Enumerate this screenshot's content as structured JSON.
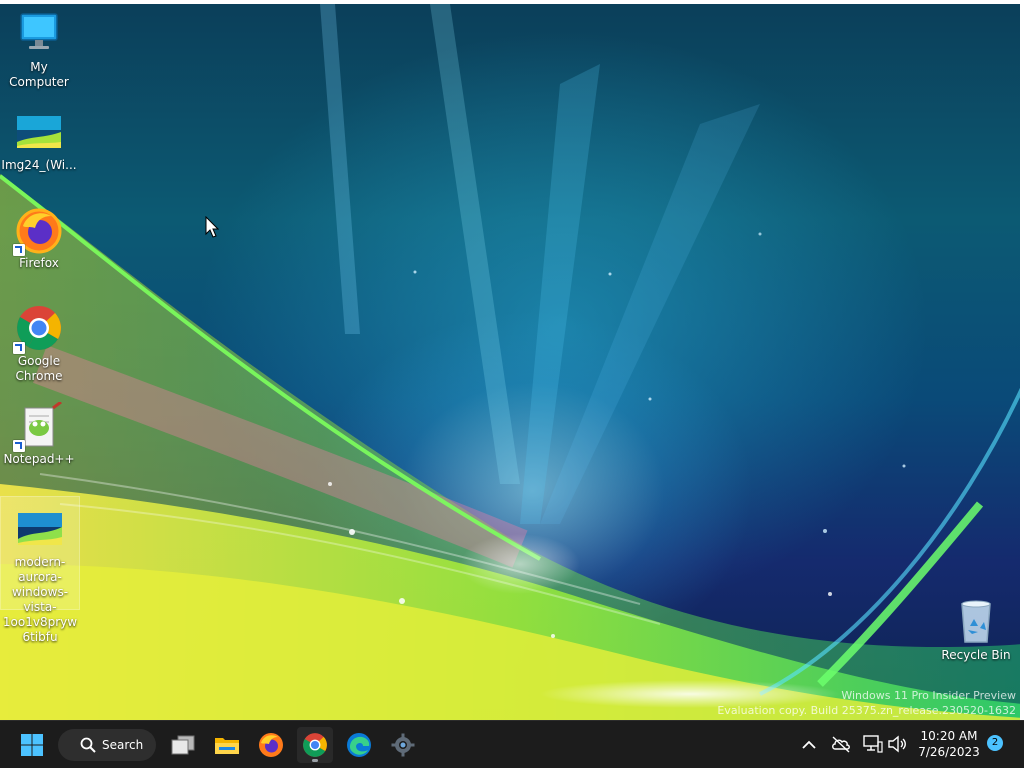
{
  "desktop": {
    "icons": [
      {
        "label": "My Computer",
        "icon": "monitor-icon",
        "shortcut": false
      },
      {
        "label": "Img24_(Wi...",
        "icon": "image-file-icon",
        "shortcut": false
      },
      {
        "label": "Firefox",
        "icon": "firefox-icon",
        "shortcut": true
      },
      {
        "label": "Google Chrome",
        "icon": "chrome-icon",
        "shortcut": true
      },
      {
        "label": "Notepad++",
        "icon": "notepad-plus-plus-icon",
        "shortcut": true
      },
      {
        "label": "modern-aurora-windows-vista-1oo1v8pryw6tibfu",
        "icon": "image-file-icon",
        "shortcut": false
      }
    ],
    "recycle_bin": {
      "label": "Recycle Bin",
      "icon": "recycle-bin-icon"
    }
  },
  "watermark": {
    "line1": "Windows 11 Pro Insider Preview",
    "line2": "Evaluation copy. Build 25375.zn_release.230520-1632"
  },
  "taskbar": {
    "start": {
      "icon": "windows-start-icon"
    },
    "search": {
      "label": "Search",
      "icon": "search-icon"
    },
    "apps": [
      {
        "name": "Task View",
        "icon": "task-view-icon",
        "active": false
      },
      {
        "name": "File Explorer",
        "icon": "file-explorer-icon",
        "active": false
      },
      {
        "name": "Firefox",
        "icon": "firefox-icon",
        "active": false
      },
      {
        "name": "Google Chrome",
        "icon": "chrome-icon",
        "active": true
      },
      {
        "name": "Microsoft Edge",
        "icon": "edge-icon",
        "active": false
      },
      {
        "name": "Settings",
        "icon": "settings-gear-icon",
        "active": false
      }
    ],
    "tray": {
      "chevron": "chevron-up-icon",
      "icons": [
        "cloud-offline-icon",
        "network-icon",
        "volume-icon"
      ]
    },
    "clock": {
      "time": "10:20 AM",
      "date": "7/26/2023"
    },
    "notifications": {
      "count": "2"
    }
  },
  "colors": {
    "taskbar_bg": "#1c1c1c",
    "accent": "#4cc2ff",
    "windows_blue": "#1e90ff"
  }
}
